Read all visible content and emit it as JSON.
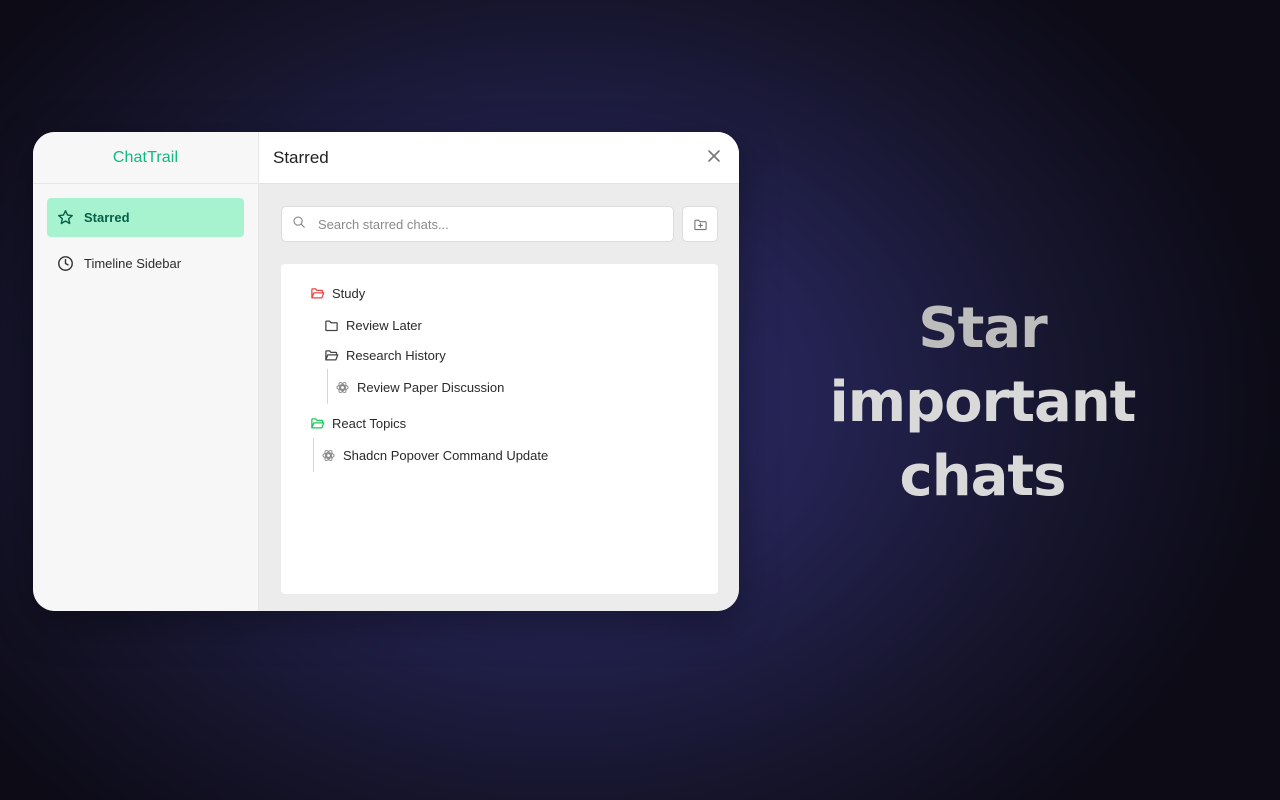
{
  "app": {
    "brand": "ChatTrail"
  },
  "sidebar": {
    "items": [
      {
        "label": "Starred",
        "icon": "star-icon",
        "active": true
      },
      {
        "label": "Timeline Sidebar",
        "icon": "clock-icon",
        "active": false
      }
    ]
  },
  "main": {
    "title": "Starred",
    "search_placeholder": "Search starred chats...",
    "tree": {
      "study": {
        "label": "Study",
        "icon": "folder-open-icon",
        "color": "#ef4444"
      },
      "review_later": {
        "label": "Review Later",
        "icon": "folder-icon"
      },
      "research_history": {
        "label": "Research History",
        "icon": "folder-open-icon"
      },
      "review_paper": {
        "label": "Review Paper Discussion",
        "icon": "chatgpt-icon"
      },
      "react_topics": {
        "label": "React Topics",
        "icon": "folder-open-icon",
        "color": "#22c55e"
      },
      "shadcn": {
        "label": "Shadcn Popover Command Update",
        "icon": "chatgpt-icon"
      }
    }
  },
  "headline": {
    "part1": "Star",
    "part2": "important",
    "part3": "chats"
  },
  "colors": {
    "accent": "#10b981",
    "active_bg": "#a7f3d0",
    "active_text": "#065f46"
  }
}
